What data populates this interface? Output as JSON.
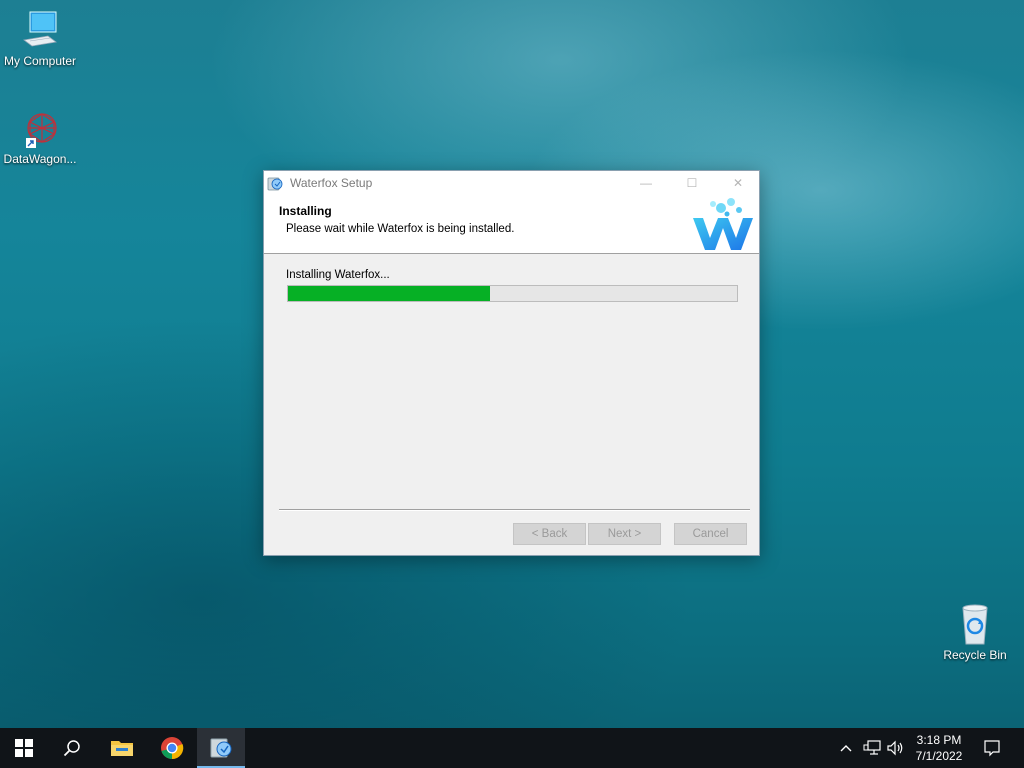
{
  "desktop": {
    "icons": [
      {
        "label": "My Computer",
        "icon": "computer-icon"
      },
      {
        "label": "DataWagon...",
        "icon": "datawagon-shortcut-icon"
      },
      {
        "label": "Recycle Bin",
        "icon": "recycle-bin-icon"
      }
    ]
  },
  "dialog": {
    "title": "Waterfox Setup",
    "header_title": "Installing",
    "header_subtitle": "Please wait while Waterfox is being installed.",
    "status": "Installing Waterfox...",
    "progress": 0.45,
    "buttons": {
      "back": "< Back",
      "next": "Next >",
      "cancel": "Cancel"
    },
    "window_controls": {
      "minimize": "—",
      "maximize": "☐",
      "close": "✕"
    }
  },
  "taskbar": {
    "items": [
      "start-icon",
      "search-icon",
      "file-explorer-icon",
      "chrome-icon",
      "waterfox-setup-icon"
    ],
    "tray": [
      "chevron-up-icon",
      "network-icon",
      "volume-icon",
      "notification-icon"
    ],
    "time": "3:18 PM",
    "date": "7/1/2022"
  },
  "colors": {
    "progress_fill": "#06b025",
    "taskbar": "#101418"
  }
}
